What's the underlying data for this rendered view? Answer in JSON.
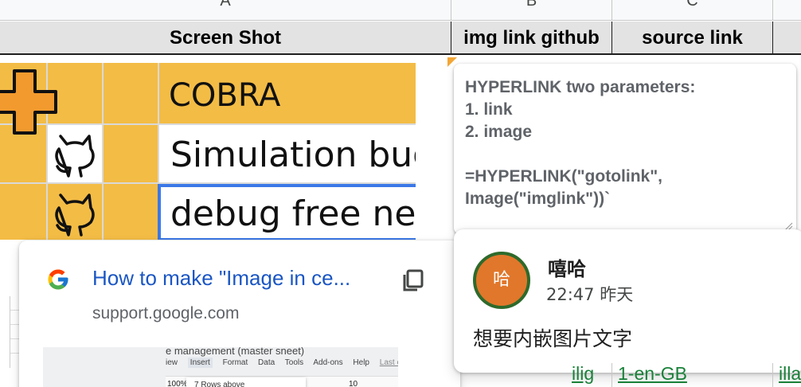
{
  "columns": {
    "letters": [
      "A",
      "B",
      "C"
    ]
  },
  "header_row": {
    "col_a": "Screen Shot",
    "col_b": "img link github",
    "col_c": "source link"
  },
  "embedded_image": {
    "rows": [
      "COBRA",
      "Simulation bug",
      "debug free nee"
    ]
  },
  "note": {
    "text": "HYPERLINK two parameters:\n1. link\n2. image\n\n=HYPERLINK(\"gotolink\", Image(\"imglink\"))`"
  },
  "link_preview": {
    "title": "How to make \"Image in ce...",
    "domain": "support.google.com",
    "thumb_title": "e management (master sneet)",
    "thumb_menu": [
      "iew",
      "Insert",
      "Format",
      "Data",
      "Tools",
      "Add-ons",
      "Help",
      "Last edit was"
    ],
    "thumb_dropdown": "7 Rows above",
    "thumb_zoom": "100%",
    "thumb_size": "10"
  },
  "comment": {
    "avatar_text": "哈",
    "author": "嘻哈",
    "time": "22:47 昨天",
    "body": "想要内嵌图片文字"
  },
  "bottom_row": {
    "cell_b": "ilig",
    "cell_c": "1-en-GB",
    "cell_d": "illa"
  },
  "colors": {
    "embed_bg": "#f3bc45",
    "link_blue": "#1a56c4",
    "sheet_link_green": "#188038",
    "avatar_bg": "#e1772a",
    "avatar_ring": "#2e6a2b",
    "selection_blue": "#3b78e7"
  }
}
